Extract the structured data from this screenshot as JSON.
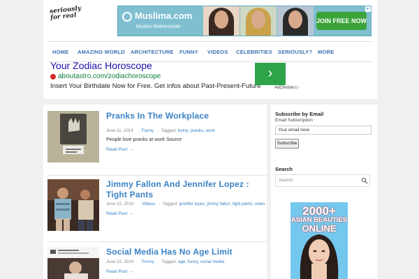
{
  "site": {
    "logo_text": "seriously for real"
  },
  "banner_ad": {
    "brand": "Muslima.com",
    "sub": "Muslim Matrimonials",
    "cta": "JOIN FREE NOW",
    "adchoices_mark": "▸"
  },
  "nav": {
    "items": [
      "HOME",
      "AMAZING WORLD",
      "ARCHITECTURE",
      "FUNNY",
      "VIDEOS",
      "CELEBRITIES",
      "SERIOUSLY?",
      "MORE"
    ]
  },
  "text_ad": {
    "title": "Your Zodiac Horoscope",
    "url": "aboutastro.com/zodiachoroscope",
    "text": "Insert Your Birthdate Now for Free. Get infos about Past-Present-Future",
    "button": "›",
    "adchoices": "AdChoices ▷"
  },
  "posts": [
    {
      "title": "Pranks In The Workplace",
      "date": "June 11, 2014",
      "category": "Funny",
      "tagged_label": "Tagged:",
      "tags": "funny, pranks, work",
      "excerpt": "People love pranks at work Source",
      "read_more": "Read Post →"
    },
    {
      "title": "Jimmy Fallon And Jennifer Lopez : Tight Pants",
      "date": "June 10, 2014",
      "category": "Videos",
      "tagged_label": "Tagged:",
      "tags": "jennifer lopez, jimmy fallon, tight pants, video",
      "excerpt": "",
      "read_more": "Read Post →"
    },
    {
      "title": "Social Media Has No Age Limit",
      "date": "June 10, 2014",
      "category": "Funny",
      "tagged_label": "Tagged:",
      "tags": "age, funny, social media",
      "excerpt": "",
      "read_more": "Read Post →"
    }
  ],
  "sidebar": {
    "subscribe": {
      "title": "Subscribe by Email",
      "label": "Email Subscription",
      "input_value": "Your email here",
      "button": "Subscribe"
    },
    "search": {
      "title": "Search",
      "placeholder": "Search"
    },
    "ad": {
      "headline": "2000+",
      "line2": "ASIAN BEAUTIES",
      "line3": "ONLINE"
    }
  },
  "colors": {
    "link": "#3a82c4",
    "nav": "#3a6fb0",
    "ad_green": "#2ea34a"
  }
}
